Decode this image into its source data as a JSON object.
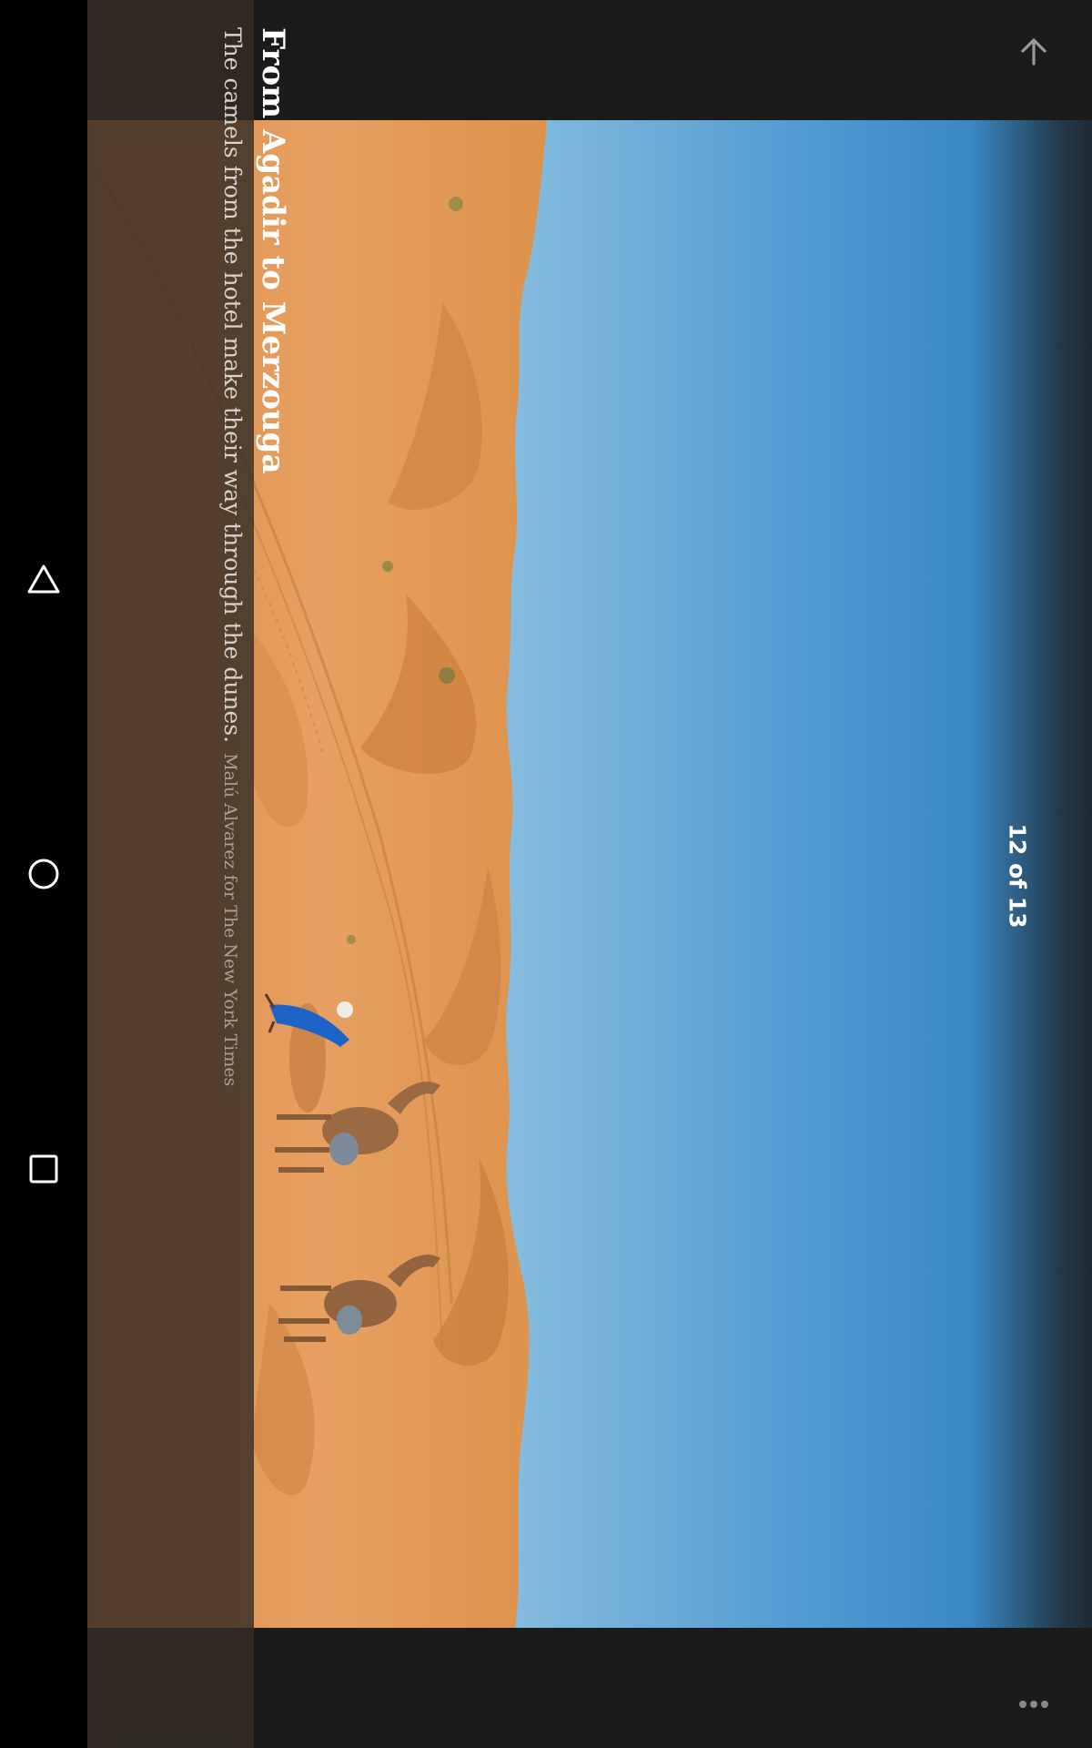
{
  "system_nav": {
    "back_icon": "triangle-back-icon",
    "home_icon": "circle-home-icon",
    "recents_icon": "square-recents-icon"
  },
  "toolbar": {
    "up_icon": "arrow-up-icon",
    "overflow_icon": "more-dots-icon"
  },
  "slideshow": {
    "counter": "12 of 13"
  },
  "caption": {
    "title": "From Agadir to Merzouga",
    "description": "The camels from the hotel make their way through the dunes.",
    "credit": "Malú Alvarez for The New York Times"
  },
  "colors": {
    "sand": "#e49a58",
    "sky_light": "#b9dbe9",
    "sky_deep": "#3a8bc8",
    "robe_blue": "#1e63c8",
    "caption_bg": "#342c26"
  }
}
